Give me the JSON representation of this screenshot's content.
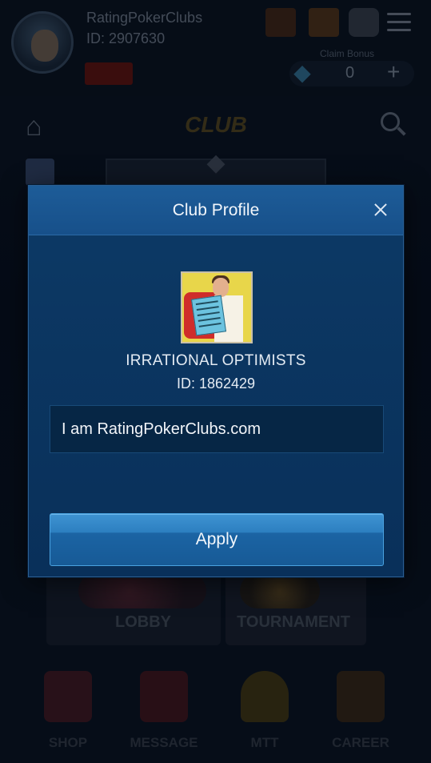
{
  "background": {
    "username": "RatingPokerClubs",
    "user_id": "ID: 2907630",
    "claim_bonus_label": "Claim Bonus",
    "gem_count": "0",
    "gem_plus": "+",
    "club_title": "CLUB",
    "tiles": {
      "lobby": "LOBBY",
      "tournament": "TOURNAMENT"
    },
    "nav": {
      "shop": "SHOP",
      "message": "MESSAGE",
      "mtt": "MTT",
      "career": "CAREER"
    }
  },
  "modal": {
    "title": "Club Profile",
    "club_name": "IRRATIONAL OPTIMISTS",
    "club_id": "ID: 1862429",
    "description": "I am RatingPokerClubs.com",
    "apply_label": "Apply"
  },
  "icons": [
    "avatar",
    "gift-icon",
    "home-icon",
    "search-icon",
    "gem-icon",
    "menu-icon",
    "close-icon",
    "club-logo"
  ],
  "colors": {
    "modal_bg": "#0b3560",
    "header_bg": "#1b5690",
    "accent_button": "#2c7fc0"
  }
}
